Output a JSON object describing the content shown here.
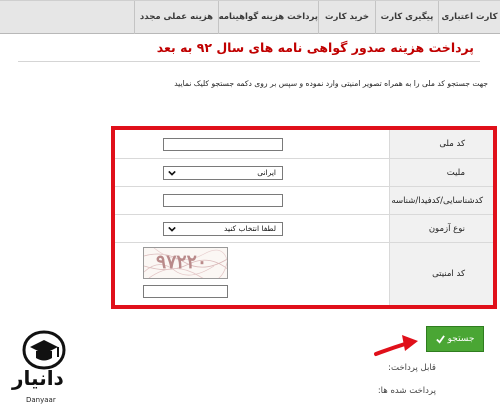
{
  "nav": {
    "items": [
      "کارت اعتباری",
      "پیگیری کارت",
      "خرید کارت",
      "پرداخت هزینه گواهینامه",
      "هزینه عملی مجدد"
    ]
  },
  "page": {
    "title": "پرداخت هزینه صدور گواهی نامه های سال ۹۲ به بعد",
    "instruction": "جهت جستجو کد ملی را به همراه تصویر امنیتی وارد نموده و سپس بر روی دکمه جستجو کلیک نمایید"
  },
  "form": {
    "national_code": {
      "label": "کد ملی",
      "value": ""
    },
    "nationality": {
      "label": "ملیت",
      "selected": "ایرانی"
    },
    "tracking": {
      "label": "کدشناسایی/کدفیدا/شناسه فراگیر",
      "value": ""
    },
    "exam_type": {
      "label": "نوع آزمون",
      "selected": "لطفا انتخاب کنید"
    },
    "captcha": {
      "label": "کد امنیتی",
      "image_text": "۹۷۲۲۰",
      "value": ""
    }
  },
  "actions": {
    "search_label": "جستجو",
    "search_icon": "checkmark-icon"
  },
  "summary": {
    "payable_label": "قابل پرداخت:",
    "paid_label": "پرداخت شده ها:"
  },
  "brand": {
    "name": "دانیار",
    "latin": "Danyaar"
  },
  "colors": {
    "accent_red": "#e0101a",
    "title_red": "#c00000",
    "button_green": "#4aa634"
  }
}
